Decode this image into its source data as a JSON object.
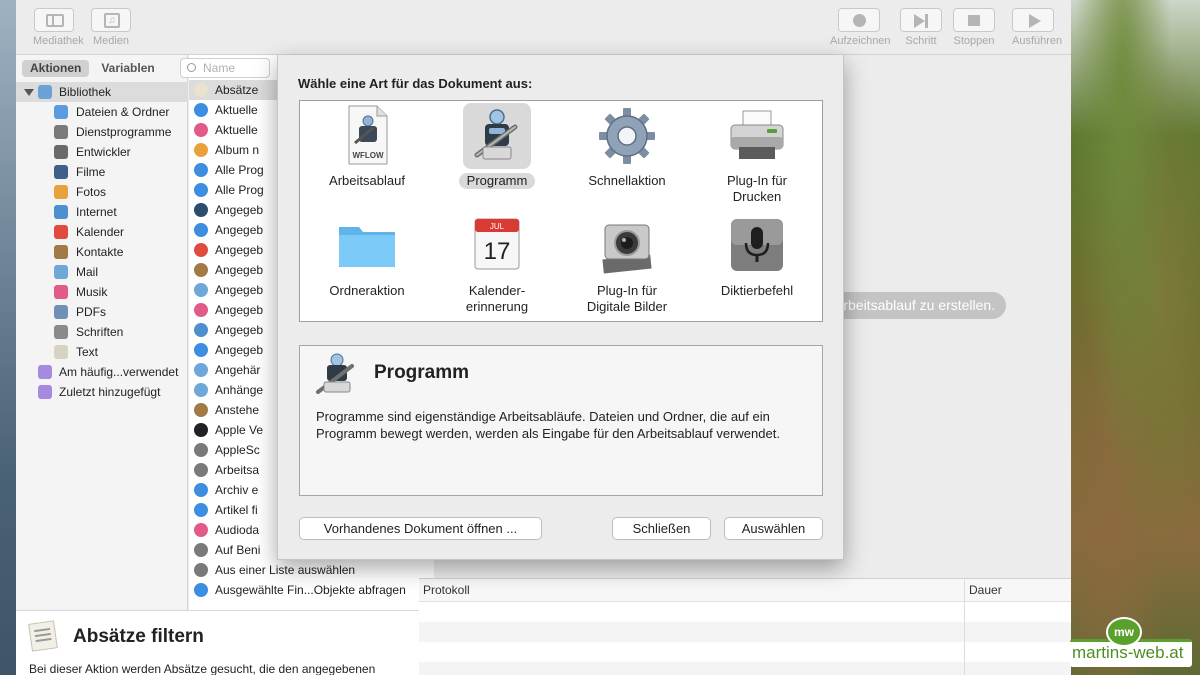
{
  "toolbar": {
    "left": [
      {
        "label": "Mediathek",
        "icon": "library-icon"
      },
      {
        "label": "Medien",
        "icon": "media-icon"
      }
    ],
    "right": [
      {
        "label": "Aufzeichnen",
        "icon": "record-icon"
      },
      {
        "label": "Schritt",
        "icon": "step-icon"
      },
      {
        "label": "Stoppen",
        "icon": "stop-icon"
      },
      {
        "label": "Ausführen",
        "icon": "run-icon"
      }
    ]
  },
  "library": {
    "tabs": [
      "Aktionen",
      "Variablen"
    ],
    "search_placeholder": "Name",
    "items": [
      {
        "label": "Bibliothek",
        "level": 0,
        "color": "#6aa2d8",
        "selected": true
      },
      {
        "label": "Dateien & Ordner",
        "level": 1,
        "color": "#5d9be0"
      },
      {
        "label": "Dienstprogramme",
        "level": 1,
        "color": "#7a7a7a"
      },
      {
        "label": "Entwickler",
        "level": 1,
        "color": "#6a6a6a"
      },
      {
        "label": "Filme",
        "level": 1,
        "color": "#3f5f8a"
      },
      {
        "label": "Fotos",
        "level": 1,
        "color": "#e9a23b"
      },
      {
        "label": "Internet",
        "level": 1,
        "color": "#4d8fcf"
      },
      {
        "label": "Kalender",
        "level": 1,
        "color": "#e04b3f"
      },
      {
        "label": "Kontakte",
        "level": 1,
        "color": "#a27a45"
      },
      {
        "label": "Mail",
        "level": 1,
        "color": "#6fa7d9"
      },
      {
        "label": "Musik",
        "level": 1,
        "color": "#e25a86"
      },
      {
        "label": "PDFs",
        "level": 1,
        "color": "#6f8fb5"
      },
      {
        "label": "Schriften",
        "level": 1,
        "color": "#8a8a8a"
      },
      {
        "label": "Text",
        "level": 1,
        "color": "#d7d2c2"
      },
      {
        "label": "Am häufig...verwendet",
        "level": 0,
        "color": "#a58ae0"
      },
      {
        "label": "Zuletzt hinzugefügt",
        "level": 0,
        "color": "#a58ae0"
      }
    ]
  },
  "actions": [
    {
      "label": "Absätze",
      "color": "#e8e2cf",
      "selected": true
    },
    {
      "label": "Aktuelle",
      "color": "#3d8ee0"
    },
    {
      "label": "Aktuelle",
      "color": "#e25a86"
    },
    {
      "label": "Album n",
      "color": "#e9a23b"
    },
    {
      "label": "Alle Prog",
      "color": "#3d8ee0"
    },
    {
      "label": "Alle Prog",
      "color": "#3d8ee0"
    },
    {
      "label": "Angegeb",
      "color": "#2d4d6e"
    },
    {
      "label": "Angegeb",
      "color": "#3d8ee0"
    },
    {
      "label": "Angegeb",
      "color": "#e04b3f"
    },
    {
      "label": "Angegeb",
      "color": "#a27a45"
    },
    {
      "label": "Angegeb",
      "color": "#6fa7d9"
    },
    {
      "label": "Angegeb",
      "color": "#e25a86"
    },
    {
      "label": "Angegeb",
      "color": "#4d8fcf"
    },
    {
      "label": "Angegeb",
      "color": "#3d8ee0"
    },
    {
      "label": "Angehär",
      "color": "#6fa7d9"
    },
    {
      "label": "Anhänge",
      "color": "#6fa7d9"
    },
    {
      "label": "Anstehe",
      "color": "#a27a45"
    },
    {
      "label": "Apple Ve",
      "color": "#222222"
    },
    {
      "label": "AppleSc",
      "color": "#7a7a7a"
    },
    {
      "label": "Arbeitsa",
      "color": "#7a7a7a"
    },
    {
      "label": "Archiv e",
      "color": "#3d8ee0"
    },
    {
      "label": "Artikel fi",
      "color": "#3d8ee0"
    },
    {
      "label": "Audioda",
      "color": "#e25a86"
    },
    {
      "label": "Auf Beni",
      "color": "#7a7a7a"
    },
    {
      "label": "Aus einer Liste auswählen",
      "color": "#7a7a7a"
    },
    {
      "label": "Ausgewählte Fin...Objekte abfragen",
      "color": "#3d8ee0"
    }
  ],
  "description": {
    "title": "Absätze filtern",
    "text": "Bei dieser Aktion werden Absätze gesucht, die den angegebenen"
  },
  "workflow": {
    "hint": "Arbeitsablauf zu erstellen.",
    "log_columns": [
      "Protokoll",
      "Dauer"
    ]
  },
  "sheet": {
    "prompt": "Wähle eine Art für das Dokument aus:",
    "types": [
      {
        "label": "Arbeitsablauf",
        "icon": "workflow-document-icon",
        "selected": false
      },
      {
        "label": "Programm",
        "icon": "automator-robot-icon",
        "selected": true
      },
      {
        "label": "Schnellaktion",
        "icon": "gear-icon",
        "selected": false
      },
      {
        "label": "Plug-In für\nDrucken",
        "icon": "printer-icon",
        "selected": false
      },
      {
        "label": "Ordneraktion",
        "icon": "folder-icon",
        "selected": false
      },
      {
        "label": "Kalender-\nerinnerung",
        "icon": "calendar-icon",
        "selected": false
      },
      {
        "label": "Plug-In für\nDigitale Bilder",
        "icon": "camera-icon",
        "selected": false
      },
      {
        "label": "Diktierbefehl",
        "icon": "microphone-icon",
        "selected": false
      }
    ],
    "calendar_month": "JUL",
    "calendar_day": "17",
    "workflow_badge": "WFLOW",
    "info": {
      "title": "Programm",
      "text": "Programme sind eigenständige Arbeitsabläufe. Dateien und Ordner, die auf ein Programm bewegt werden, werden als Eingabe für den Arbeitsablauf verwendet."
    },
    "buttons": {
      "open_existing": "Vorhandenes Dokument öffnen ...",
      "close": "Schließen",
      "choose": "Auswählen"
    }
  },
  "watermark": {
    "badge": "mw",
    "text": "martins-web.at"
  }
}
